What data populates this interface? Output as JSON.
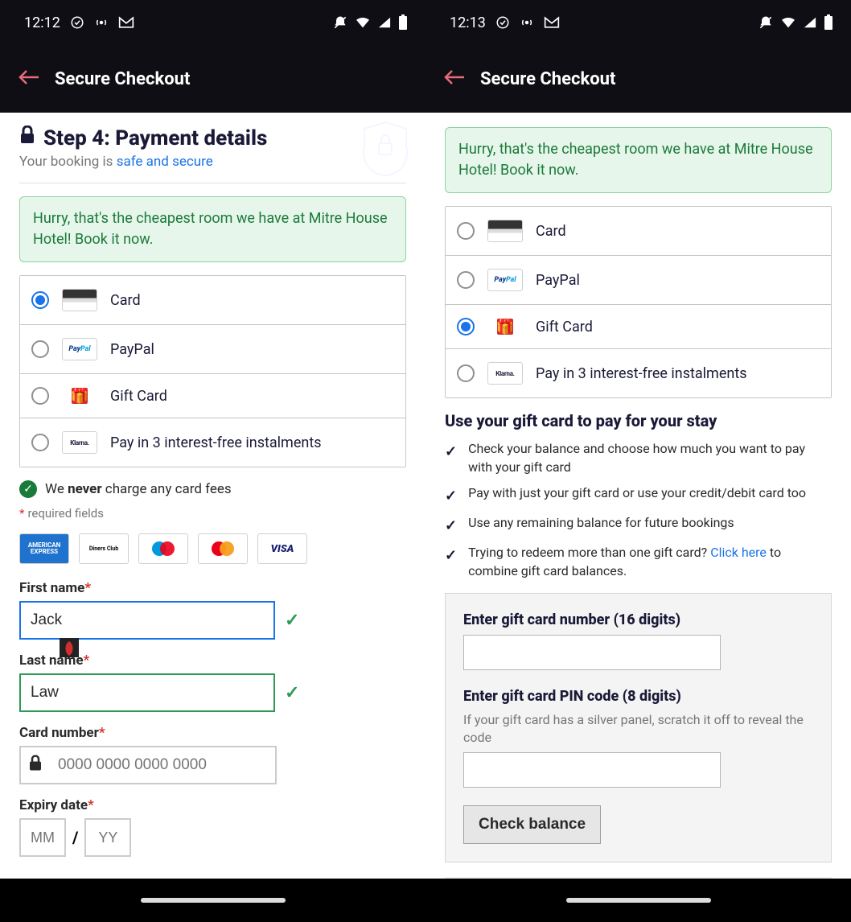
{
  "left": {
    "status": {
      "time": "12:12"
    },
    "header": {
      "title": "Secure Checkout"
    },
    "step": {
      "title": "Step 4: Payment details",
      "subtitle_prefix": "Your booking is ",
      "subtitle_link": "safe and secure"
    },
    "banner": "Hurry, that's the cheapest room we have at Mitre House Hotel! Book it now.",
    "methods": [
      {
        "label": "Card",
        "selected": true,
        "icon": "card-icon"
      },
      {
        "label": "PayPal",
        "selected": false,
        "icon": "paypal-icon",
        "icon_text": "PayPal"
      },
      {
        "label": "Gift Card",
        "selected": false,
        "icon": "giftcard-icon"
      },
      {
        "label": "Pay in 3 interest-free instalments",
        "selected": false,
        "icon": "klarna-icon",
        "icon_text": "Klarna."
      }
    ],
    "no_fees_prefix": "We ",
    "no_fees_strong": "never",
    "no_fees_suffix": " charge any card fees",
    "required": "required fields",
    "logos": [
      "AMERICAN EXPRESS",
      "Diners Club",
      "maestro",
      "mastercard",
      "VISA"
    ],
    "fields": {
      "first_name_label": "First name",
      "first_name_value": "Jack",
      "last_name_label": "Last name",
      "last_name_value": "Law",
      "card_number_label": "Card number",
      "card_number_placeholder": "0000 0000 0000 0000",
      "expiry_label": "Expiry date",
      "expiry_mm": "MM",
      "expiry_yy": "YY",
      "expiry_sep": "/"
    }
  },
  "right": {
    "status": {
      "time": "12:13"
    },
    "header": {
      "title": "Secure Checkout"
    },
    "banner": "Hurry, that's the cheapest room we have at Mitre House Hotel! Book it now.",
    "methods": [
      {
        "label": "Card",
        "selected": false,
        "icon": "card-icon"
      },
      {
        "label": "PayPal",
        "selected": false,
        "icon": "paypal-icon",
        "icon_text": "PayPal"
      },
      {
        "label": "Gift Card",
        "selected": true,
        "icon": "giftcard-icon"
      },
      {
        "label": "Pay in 3 interest-free instalments",
        "selected": false,
        "icon": "klarna-icon",
        "icon_text": "Klarna."
      }
    ],
    "gift": {
      "title": "Use your gift card to pay for your stay",
      "bullets": [
        {
          "text": "Check your balance and choose how much you want to pay with your gift card"
        },
        {
          "text": "Pay with just your gift card or use your credit/debit card too"
        },
        {
          "text": "Use any remaining balance for future bookings"
        },
        {
          "text_prefix": "Trying to redeem more than one gift card? ",
          "link": "Click here",
          "text_suffix": " to combine gift card balances."
        }
      ],
      "number_label": "Enter gift card number (16 digits)",
      "pin_label": "Enter gift card PIN code (8 digits)",
      "pin_hint": "If your gift card has a silver panel, scratch it off to reveal the code",
      "check_button": "Check balance"
    }
  }
}
